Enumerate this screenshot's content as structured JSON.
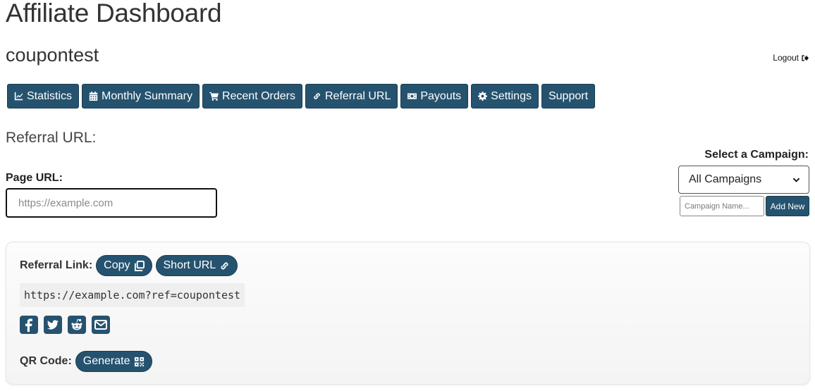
{
  "header": {
    "title": "Affiliate Dashboard",
    "username": "coupontest",
    "logout_label": "Logout"
  },
  "nav": {
    "items": [
      {
        "label": "Statistics",
        "icon": "chart-line-icon"
      },
      {
        "label": "Monthly Summary",
        "icon": "calendar-icon"
      },
      {
        "label": "Recent Orders",
        "icon": "shopping-cart-icon"
      },
      {
        "label": "Referral URL",
        "icon": "link-icon"
      },
      {
        "label": "Payouts",
        "icon": "money-bill-icon"
      },
      {
        "label": "Settings",
        "icon": "gear-icon"
      },
      {
        "label": "Support",
        "icon": ""
      }
    ]
  },
  "referral": {
    "section_title": "Referral URL:",
    "page_url_label": "Page URL:",
    "page_url_value": "",
    "page_url_placeholder": "https://example.com"
  },
  "campaign": {
    "label": "Select a Campaign:",
    "selected": "All Campaigns",
    "name_placeholder": "Campaign Name...",
    "add_new_label": "Add New"
  },
  "card": {
    "referral_link_label": "Referral Link:",
    "copy_label": "Copy",
    "short_url_label": "Short URL",
    "referral_link": "https://example.com?ref=coupontest",
    "share_icons": [
      "facebook-icon",
      "twitter-icon",
      "reddit-icon",
      "email-icon"
    ],
    "qr_label": "QR Code:",
    "generate_label": "Generate"
  },
  "colors": {
    "primary": "#25536f",
    "text": "#333333",
    "code_bg": "#efefef"
  }
}
